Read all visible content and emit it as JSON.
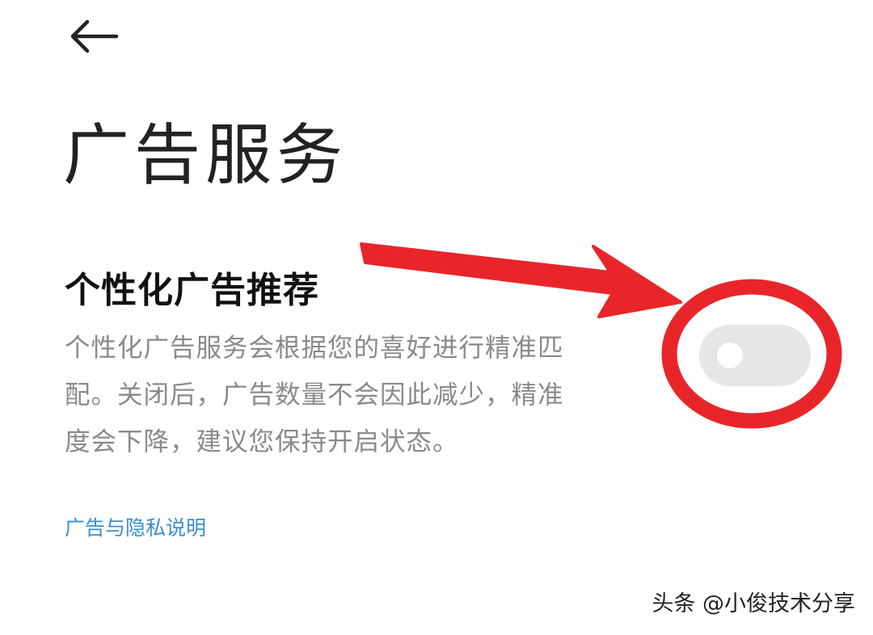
{
  "header": {
    "back_icon": "arrow-left-icon"
  },
  "page": {
    "title": "广告服务"
  },
  "setting": {
    "title": "个性化广告推荐",
    "description": "个性化广告服务会根据您的喜好进行精准匹\n配。关闭后，广告数量不会因此减少，精准\n度会下降，建议您保持开启状态。",
    "toggle_on": false,
    "toggle_color": "#e6e6e6"
  },
  "footer": {
    "privacy_link": "广告与隐私说明",
    "link_color": "#3a8fd0"
  },
  "overlay": {
    "watermark": "头条 @小俊技术分享",
    "annotation_color": "#e8262a",
    "annotation_shapes": [
      "arrow",
      "circle"
    ]
  }
}
